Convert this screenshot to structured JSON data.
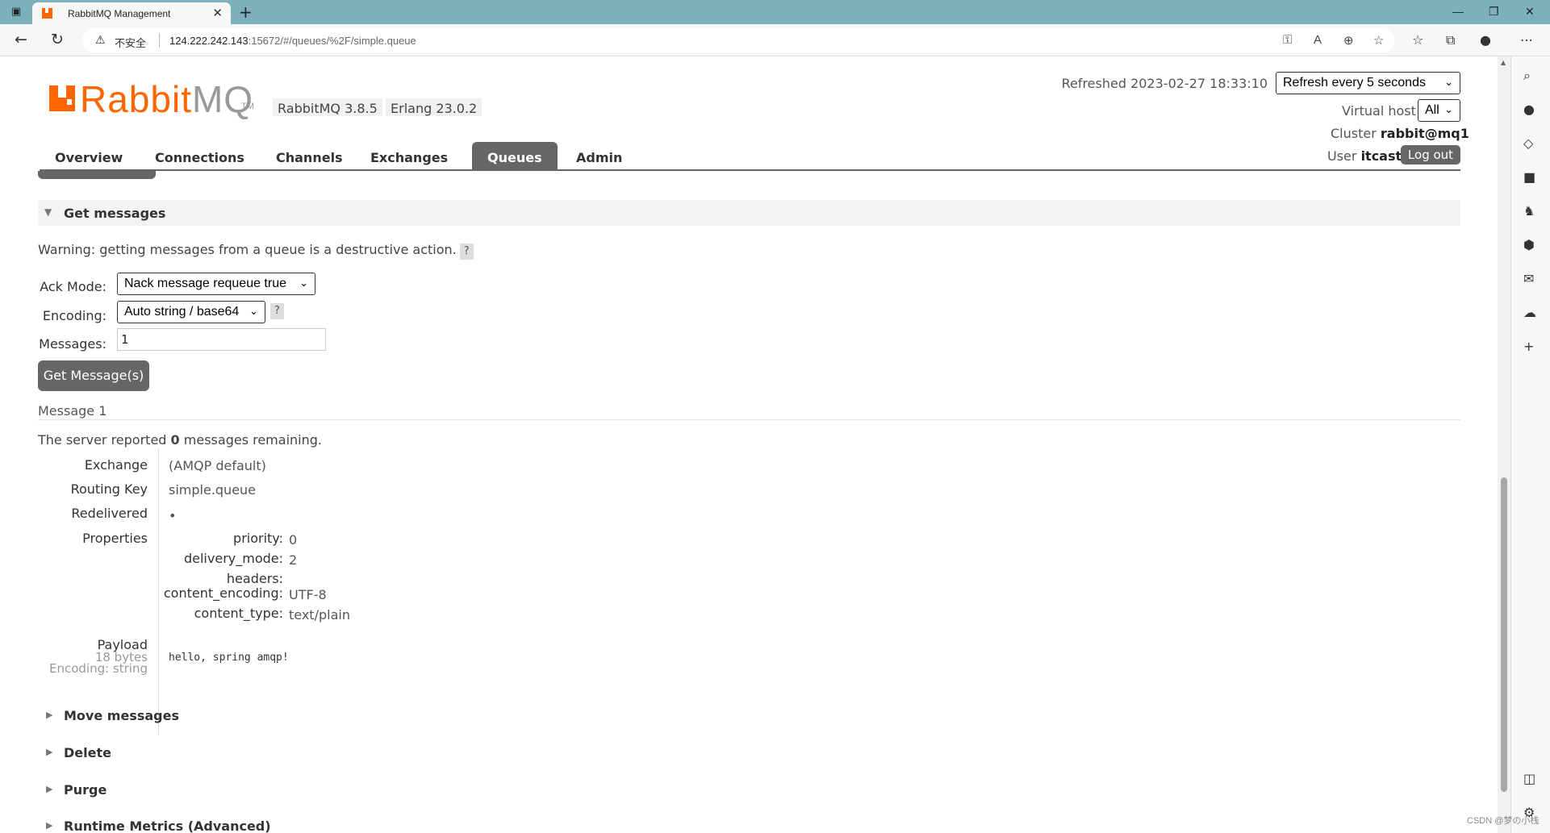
{
  "browser": {
    "tab_title": "RabbitMQ Management",
    "insecure_label": "不安全",
    "url_host": "124.222.242.143",
    "url_path": ":15672/#/queues/%2F/simple.queue"
  },
  "header": {
    "logo_rabbit": "Rabbit",
    "logo_mq": "MQ",
    "logo_tm": "TM",
    "version": "RabbitMQ 3.8.5",
    "erlang": "Erlang 23.0.2",
    "refreshed": "Refreshed 2023-02-27 18:33:10",
    "refresh_option": "Refresh every 5 seconds",
    "vhost_label": "Virtual host",
    "vhost_value": "All",
    "cluster_label": "Cluster",
    "cluster_value": "rabbit@mq1",
    "user_label": "User",
    "user_value": "itcast",
    "logout": "Log out"
  },
  "nav": {
    "tabs": [
      "Overview",
      "Connections",
      "Channels",
      "Exchanges",
      "Queues",
      "Admin"
    ],
    "active": "Queues"
  },
  "get_messages": {
    "title": "Get messages",
    "warning": "Warning: getting messages from a queue is a destructive action.",
    "help": "?",
    "ack_label": "Ack Mode:",
    "ack_value": "Nack message requeue true",
    "encoding_label": "Encoding:",
    "encoding_value": "Auto string / base64",
    "messages_label": "Messages:",
    "messages_value": "1",
    "button": "Get Message(s)"
  },
  "message": {
    "title": "Message 1",
    "remaining_prefix": "The server reported",
    "remaining_count": "0",
    "remaining_suffix": "messages remaining.",
    "exchange_label": "Exchange",
    "exchange_value": "(AMQP default)",
    "routing_label": "Routing Key",
    "routing_value": "simple.queue",
    "redelivered_label": "Redelivered",
    "redelivered_value": "•",
    "properties_label": "Properties",
    "properties": [
      {
        "key": "priority:",
        "value": "0"
      },
      {
        "key": "delivery_mode:",
        "value": "2"
      },
      {
        "key": "headers:",
        "value": ""
      },
      {
        "key": "content_encoding:",
        "value": "UTF-8"
      },
      {
        "key": "content_type:",
        "value": "text/plain"
      }
    ],
    "payload_label": "Payload",
    "payload_size": "18 bytes",
    "payload_encoding": "Encoding: string",
    "payload_value": "hello, spring amqp!"
  },
  "sections": [
    "Move messages",
    "Delete",
    "Purge",
    "Runtime Metrics (Advanced)"
  ],
  "watermark": "CSDN @梦の小栈"
}
